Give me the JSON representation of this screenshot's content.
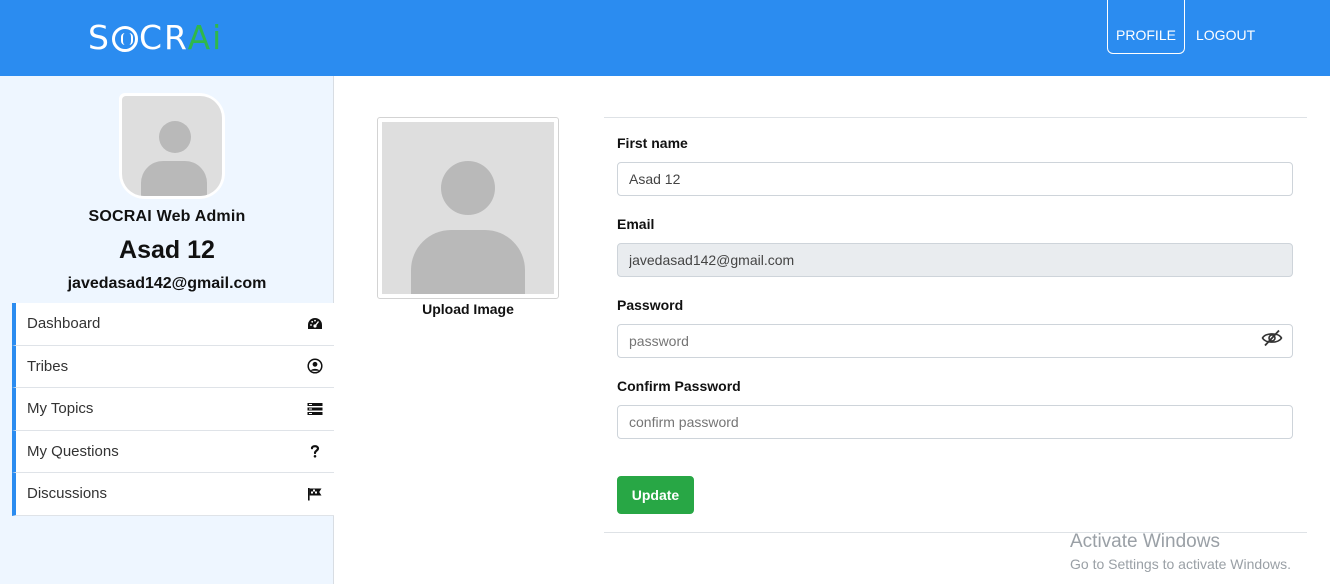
{
  "header": {
    "logo": {
      "before": "S",
      "after": "CR",
      "accent": "Ai"
    },
    "nav": {
      "profile": "PROFILE",
      "logout": "LOGOUT"
    },
    "colors": {
      "bar": "#2b8cf0",
      "accent": "#2fb84a"
    }
  },
  "sidebar": {
    "role": "SOCRAI Web Admin",
    "name": "Asad 12",
    "email": "javedasad142@gmail.com",
    "items": [
      {
        "label": "Dashboard",
        "icon": "dashboard-icon"
      },
      {
        "label": "Tribes",
        "icon": "user-circle-icon"
      },
      {
        "label": "My Topics",
        "icon": "list-icon"
      },
      {
        "label": "My Questions",
        "icon": "question-icon"
      },
      {
        "label": "Discussions",
        "icon": "flag-icon"
      }
    ]
  },
  "profile_image": {
    "upload_label": "Upload Image"
  },
  "form": {
    "first_name": {
      "label": "First name",
      "value": "Asad 12"
    },
    "email": {
      "label": "Email",
      "value": "javedasad142@gmail.com"
    },
    "password": {
      "label": "Password",
      "placeholder": "password",
      "value": ""
    },
    "confirm_password": {
      "label": "Confirm Password",
      "placeholder": "confirm password",
      "value": ""
    },
    "submit_label": "Update"
  },
  "watermark": {
    "title": "Activate Windows",
    "subtitle": "Go to Settings to activate Windows."
  }
}
